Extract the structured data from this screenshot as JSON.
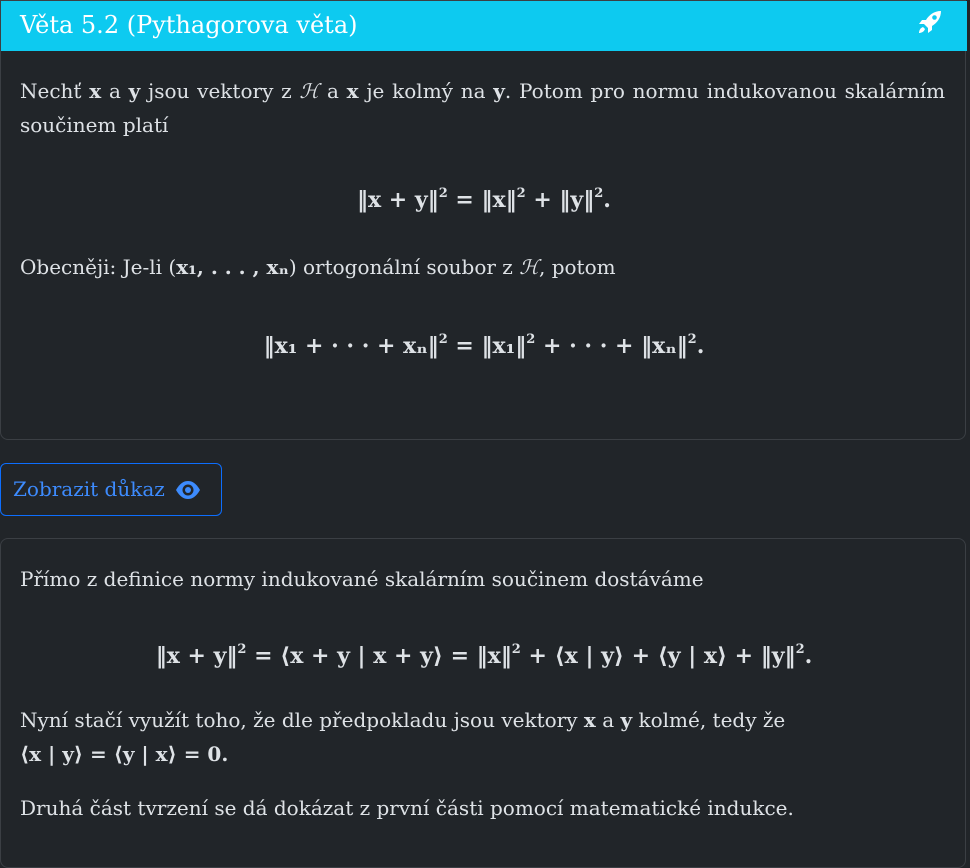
{
  "theorem": {
    "title": "Věta 5.2 (Pythagorova věta)",
    "p1_a": "Nechť",
    "x": "x",
    "p1_b": "a",
    "y": "y",
    "p1_c": "jsou vektory z",
    "H": "ℋ",
    "p1_d": "a",
    "p1_e": "je kolmý na",
    "p1_f": ". Potom pro normu indukovanou skalárním součinem platí",
    "eq1_a": "‖x + y‖",
    "eq1_exp": "2",
    "eq1_b": "= ‖x‖",
    "eq1_c": "+ ‖y‖",
    "eq1_d": ".",
    "p2_a": "Obecněji: Je-li (",
    "p2_tuple": "x₁, . . . , xₙ",
    "p2_b": ") ortogonální soubor z",
    "p2_c": ", potom",
    "eq2_a": "‖x₁ + · · · + xₙ‖",
    "eq2_b": "= ‖x₁‖",
    "eq2_c": "+ · · · + ‖xₙ‖",
    "eq2_d": "."
  },
  "proof_button": {
    "label": "Zobrazit důkaz"
  },
  "proof": {
    "p1": "Přímo z definice normy indukované skalárním součinem dostáváme",
    "eq_a": "‖x + y‖",
    "eq_b": "= ⟨x + y | x + y⟩ = ‖x‖",
    "eq_c": "+ ⟨x | y⟩ + ⟨y | x⟩ + ‖y‖",
    "eq_d": ".",
    "p2_a": "Nyní stačí využít toho, že dle předpokladu jsou vektory",
    "p2_b": "a",
    "p2_c": "kolmé, tedy že",
    "p2_eq": "⟨x | y⟩ = ⟨y | x⟩ = 0.",
    "p3": "Druhá část tvrzení se dá dokázat z první části pomocí matematické indukce."
  },
  "icons": {
    "header": "rocket-icon",
    "button": "eye-icon"
  },
  "colors": {
    "header_bg": "#0dcaf0",
    "page_bg": "#212529",
    "button": "#0d6efd"
  }
}
